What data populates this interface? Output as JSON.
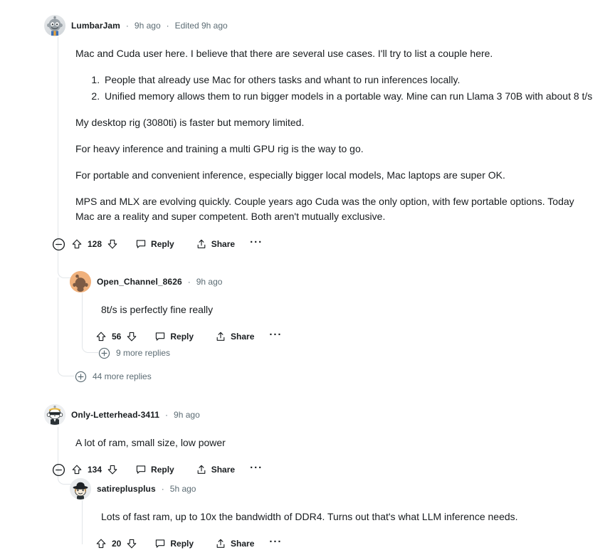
{
  "comments": [
    {
      "id": "c1",
      "author": "LumbarJam",
      "separator": "·",
      "age": "9h ago",
      "edited": "Edited 9h ago",
      "avatar_icon": "snoo-avatar-grey",
      "paragraphs": [
        "Mac and Cuda user here. I believe that there are several use cases. I'll try to list a couple here."
      ],
      "list_items": [
        "People that already use Mac for others tasks and whant to run inferences locally.",
        "Unified memory allows them to run bigger models in a portable way. Mine can run Llama 3 70B with about 8 t/s"
      ],
      "paragraphs_after": [
        "My desktop rig (3080ti) is faster but memory limited.",
        "For heavy inference and training a multi GPU rig is the way to go.",
        "For portable and convenient inference, especially bigger local models, Mac laptops are super OK.",
        "MPS and MLX are evolving quickly. Couple years ago Cuda was the only option, with few portable options. Today Mac are a reality and super competent. Both aren't mutually exclusive."
      ],
      "actions": {
        "collapse_icon": "collapse-minus-icon",
        "upvote_icon": "upvote-arrow-icon",
        "score": "128",
        "downvote_icon": "downvote-arrow-icon",
        "reply_icon": "comment-bubble-icon",
        "reply_label": "Reply",
        "share_icon": "share-upload-icon",
        "share_label": "Share",
        "more_icon": "ellipsis-icon"
      }
    },
    {
      "id": "c2",
      "author": "Open_Channel_8626",
      "separator": "·",
      "age": "9h ago",
      "avatar_icon": "snoo-avatar-orange",
      "paragraphs": [
        "8t/s is perfectly fine really"
      ],
      "actions": {
        "upvote_icon": "upvote-arrow-icon",
        "score": "56",
        "downvote_icon": "downvote-arrow-icon",
        "reply_icon": "comment-bubble-icon",
        "reply_label": "Reply",
        "share_icon": "share-upload-icon",
        "share_label": "Share",
        "more_icon": "ellipsis-icon"
      },
      "more_replies": {
        "icon": "plus-circle-icon",
        "label": "9 more replies"
      }
    },
    {
      "id": "c1_more",
      "more_replies": {
        "icon": "plus-circle-icon",
        "label": "44 more replies"
      }
    },
    {
      "id": "c3",
      "author": "Only-Letterhead-3411",
      "separator": "·",
      "age": "9h ago",
      "avatar_icon": "snoo-avatar-sunglasses",
      "paragraphs": [
        "A lot of ram, small size, low power"
      ],
      "actions": {
        "collapse_icon": "collapse-minus-icon",
        "upvote_icon": "upvote-arrow-icon",
        "score": "134",
        "downvote_icon": "downvote-arrow-icon",
        "reply_icon": "comment-bubble-icon",
        "reply_label": "Reply",
        "share_icon": "share-upload-icon",
        "share_label": "Share",
        "more_icon": "ellipsis-icon"
      }
    },
    {
      "id": "c4",
      "author": "satireplusplus",
      "separator": "·",
      "age": "5h ago",
      "avatar_icon": "snoo-avatar-hat",
      "paragraphs": [
        "Lots of fast ram, up to 10x the bandwidth of DDR4. Turns out that's what LLM inference needs."
      ],
      "actions": {
        "upvote_icon": "upvote-arrow-icon",
        "score": "20",
        "downvote_icon": "downvote-arrow-icon",
        "reply_icon": "comment-bubble-icon",
        "reply_label": "Reply",
        "share_icon": "share-upload-icon",
        "share_label": "Share",
        "more_icon": "ellipsis-icon"
      }
    }
  ],
  "colors": {
    "text": "#181c1f",
    "meta": "#5c6c74",
    "thread_line": "#e2e6e9",
    "avatar_orange": "#f0b17c"
  }
}
